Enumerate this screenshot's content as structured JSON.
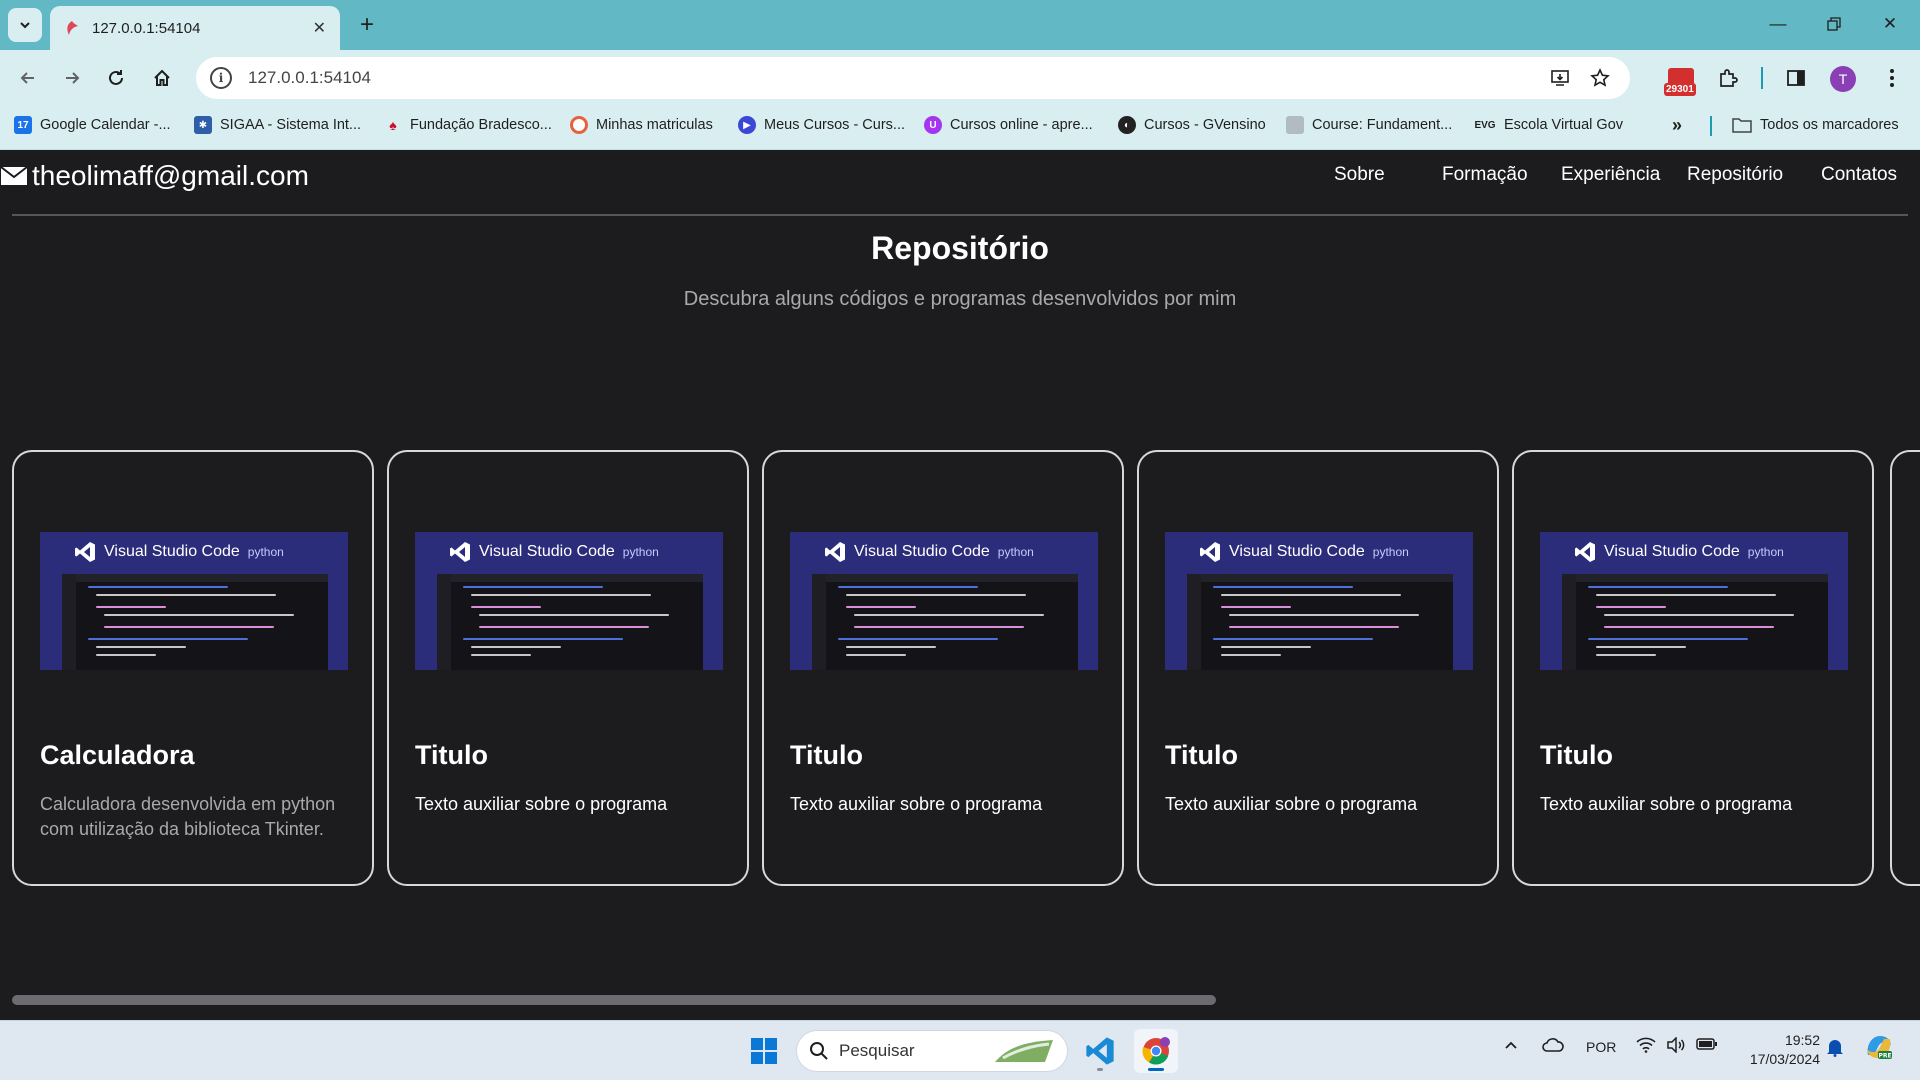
{
  "browser": {
    "tab_title": "127.0.0.1:54104",
    "url": "127.0.0.1:54104",
    "extension_badge": "29301",
    "avatar_letter": "T",
    "bookmarks": [
      {
        "label": "Google Calendar -...",
        "icon": "calendar-icon"
      },
      {
        "label": "SIGAA - Sistema Int...",
        "icon": "sigaa-icon"
      },
      {
        "label": "Fundação Bradesco...",
        "icon": "bradesco-icon"
      },
      {
        "label": "Minhas matriculas",
        "icon": "matriculas-icon"
      },
      {
        "label": "Meus Cursos - Curs...",
        "icon": "cursos-icon"
      },
      {
        "label": "Cursos online - apre...",
        "icon": "udemy-icon"
      },
      {
        "label": "Cursos - GVensino",
        "icon": "gvensino-icon"
      },
      {
        "label": "Course: Fundament...",
        "icon": "course-icon"
      },
      {
        "label": "Escola Virtual Gov",
        "icon": "evg-icon"
      }
    ],
    "all_bookmarks_label": "Todos os marcadores"
  },
  "site": {
    "email": "theolimaff@gmail.com",
    "nav": [
      "Sobre",
      "Formação",
      "Experiência",
      "Repositório",
      "Contatos"
    ],
    "heading": "Repositório",
    "subheading": "Descubra alguns códigos e programas desenvolvidos por mim",
    "thumb_title": "Visual Studio Code",
    "thumb_python": "python",
    "cards": [
      {
        "title": "Calculadora",
        "text": "Calculadora desenvolvida em python com utilização da biblioteca Tkinter."
      },
      {
        "title": "Titulo",
        "text": "Texto auxiliar sobre o programa"
      },
      {
        "title": "Titulo",
        "text": "Texto auxiliar sobre o programa"
      },
      {
        "title": "Titulo",
        "text": "Texto auxiliar sobre o programa"
      },
      {
        "title": "Titulo",
        "text": "Texto auxiliar sobre o programa"
      }
    ]
  },
  "taskbar": {
    "search_placeholder": "Pesquisar",
    "language": "POR",
    "time": "19:52",
    "date": "17/03/2024"
  },
  "colors": {
    "page_bg": "#1c1c1e",
    "browser_frame": "#62b8c4",
    "toolbar": "#d9eef1",
    "thumb_bg": "#2b2d7a"
  }
}
